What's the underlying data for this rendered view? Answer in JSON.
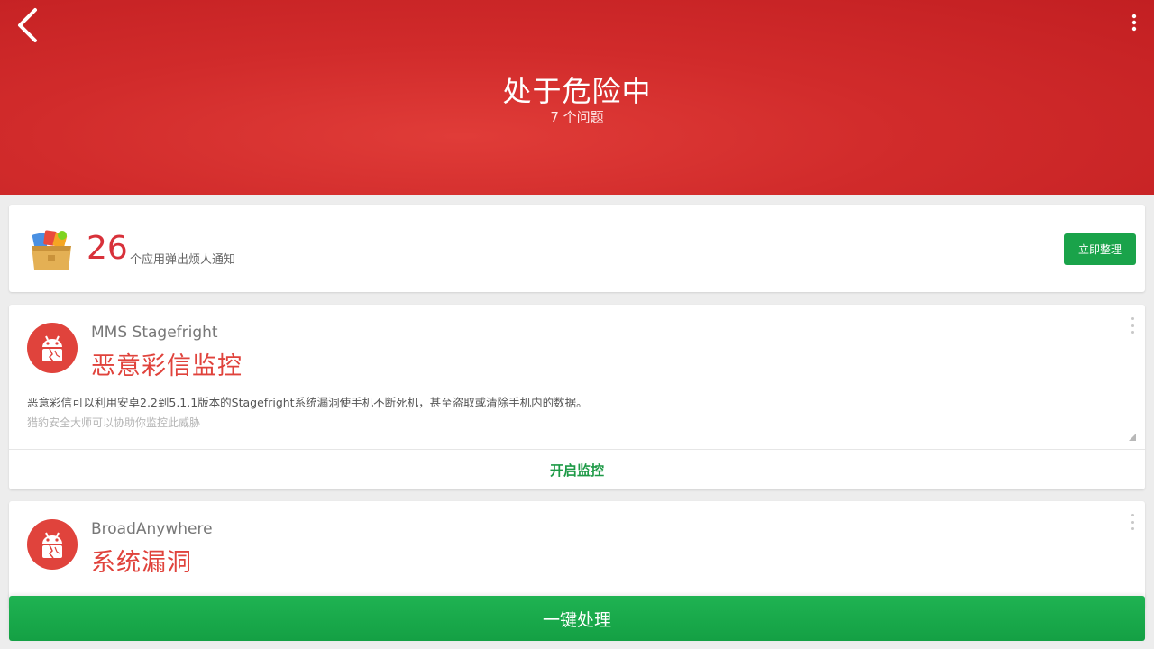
{
  "header": {
    "title": "处于危险中",
    "subtitle": "7 个问题",
    "back_icon": "chevron-left-icon",
    "menu_icon": "more-vertical-icon",
    "bg_color": "#d12b2b"
  },
  "notification_card": {
    "icon": "gift-box-icon",
    "count": "26",
    "text": "个应用弹出烦人通知",
    "action_label": "立即整理",
    "count_color": "#d8313a",
    "action_color": "#1aa34a"
  },
  "threats": [
    {
      "name": "MMS Stagefright",
      "title": "恶意彩信监控",
      "description": "恶意彩信可以利用安卓2.2到5.1.1版本的Stagefright系统漏洞使手机不断死机，甚至盗取或清除手机内的数据。",
      "hint": "猎豹安全大师可以协助你监控此威胁",
      "action_label": "开启监控",
      "icon": "broken-android-icon"
    },
    {
      "name": "BroadAnywhere",
      "title": "系统漏洞",
      "icon": "broken-android-icon"
    }
  ],
  "footer": {
    "fix_all_label": "一键处理",
    "color": "#1aa34a"
  }
}
